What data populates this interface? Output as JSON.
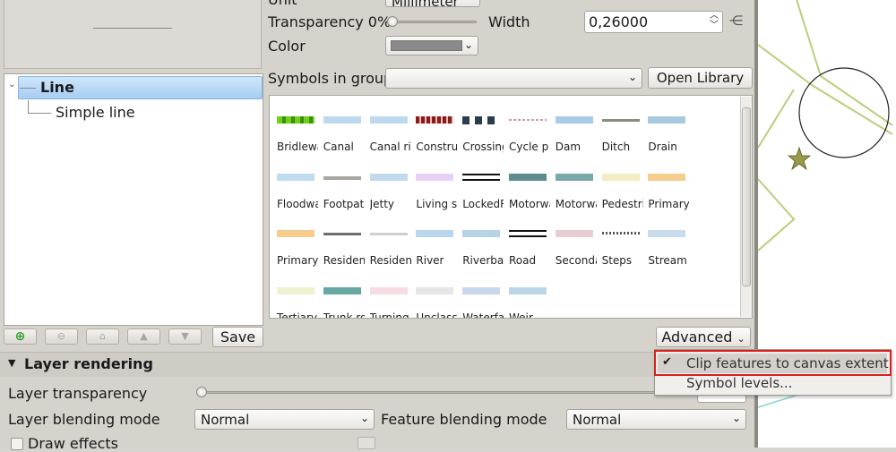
{
  "props": {
    "unit_label": "Unit",
    "unit_value": "Millimeter",
    "transparency_label": "Transparency 0%",
    "width_label": "Width",
    "width_value": "0,26000",
    "color_label": "Color"
  },
  "tree": {
    "root": "Line",
    "child": "Simple line"
  },
  "symbols": {
    "group_label": "Symbols in group",
    "open_library": "Open Library",
    "items": [
      {
        "name": "Bridlewa",
        "color": "#6fd11c"
      },
      {
        "name": "Canal",
        "color": "#bcd9ee"
      },
      {
        "name": "Canal ri",
        "color": "#bcd9ee"
      },
      {
        "name": "Constru",
        "color": "#8c1a1a"
      },
      {
        "name": "Crossing",
        "color": "#2b3d4d"
      },
      {
        "name": "Cycle p",
        "color": "#d39aa6"
      },
      {
        "name": "Dam",
        "color": "#a9cbe6"
      },
      {
        "name": "Ditch",
        "color": "#8c8a84"
      },
      {
        "name": "Drain",
        "color": "#a8c9e0"
      },
      {
        "name": "Floodwa",
        "color": "#c0dcee"
      },
      {
        "name": "Footpat",
        "color": "#a9a6a0"
      },
      {
        "name": "Jetty",
        "color": "#c3daed"
      },
      {
        "name": "Living st",
        "color": "#e7d2f4"
      },
      {
        "name": "LockedR",
        "color": "#111111"
      },
      {
        "name": "Motorwa",
        "color": "#5f8d8f"
      },
      {
        "name": "Motorwa",
        "color": "#79a9a8"
      },
      {
        "name": "Pedestri",
        "color": "#f4ecc2"
      },
      {
        "name": "Primary",
        "color": "#f6cd8c"
      },
      {
        "name": "Primary",
        "color": "#f6cd8c"
      },
      {
        "name": "Resident",
        "color": "#6d6d6d"
      },
      {
        "name": "Resident",
        "color": "#cfcfcf"
      },
      {
        "name": "River",
        "color": "#b9d6ec"
      },
      {
        "name": "Riverbar",
        "color": "#b9d3e6"
      },
      {
        "name": "Road",
        "color": "#111111"
      },
      {
        "name": "Seconda",
        "color": "#e4cdd3"
      },
      {
        "name": "Steps",
        "color": "#555555"
      },
      {
        "name": "Stream",
        "color": "#c9dceb"
      },
      {
        "name": "Tertiary",
        "color": "#f0f1cf"
      },
      {
        "name": "Trunk ro",
        "color": "#67a8a3"
      },
      {
        "name": "Turning",
        "color": "#f7dce4"
      },
      {
        "name": "Unclassi",
        "color": "#e6e6e6"
      },
      {
        "name": "Waterfal",
        "color": "#c8d6ee"
      },
      {
        "name": "Weir",
        "color": "#bad5ea"
      }
    ]
  },
  "toolbar": {
    "save_label": "Save",
    "advanced_label": "Advanced"
  },
  "layer_rendering": {
    "title": "Layer rendering",
    "transparency_label": "Layer transparency",
    "blending_label": "Layer blending mode",
    "blending_value": "Normal",
    "feature_blending_label": "Feature blending mode",
    "feature_blending_value": "Normal",
    "draw_effects": "Draw effects"
  },
  "menu": {
    "clip": "Clip features to canvas extent",
    "symbol_levels": "Symbol levels..."
  },
  "colors": {
    "accent_selection": "#a6cdf3",
    "highlight_box": "#dc1e1e",
    "map_line": "#b7d07a",
    "star": "#9a9a4a"
  }
}
